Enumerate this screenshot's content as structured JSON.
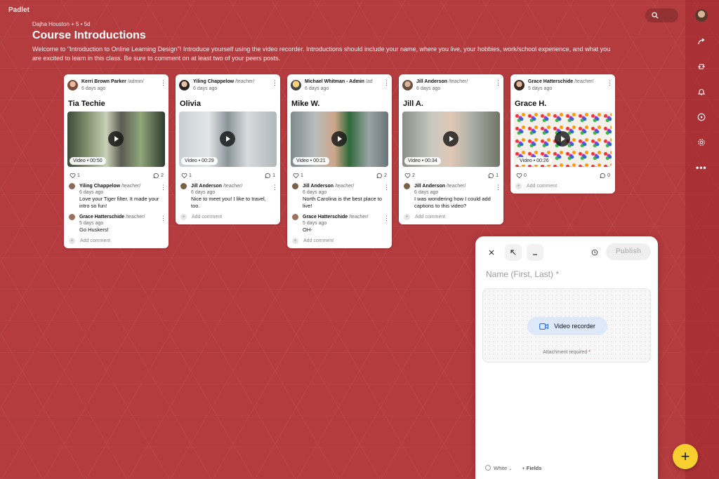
{
  "app": {
    "logo": "Padlet"
  },
  "header": {
    "author": "Dajha Houston + 5 • 5d",
    "title": "Course Introductions",
    "description": "Welcome to \"Introduction to Online Learning Design\"! Introduce yourself using the video recorder. Introductions should include your name, where you live, your hobbies, work/school experience, and what you are excited to learn in this class. Be sure to comment on at least two of your peers posts."
  },
  "rail": {
    "icons": [
      "share-icon",
      "remake-icon",
      "bell-icon",
      "play-icon",
      "gear-icon",
      "more-icon"
    ],
    "more": "•••"
  },
  "cards": [
    {
      "author": "Kerri Brown Parker",
      "role": "/admin/",
      "ago": "6 days ago",
      "title": "Tia Techie",
      "video_label": "Video",
      "duration": "00:50",
      "likes": "1",
      "comments_count": "2",
      "comments": [
        {
          "author": "Yiling Chappelow",
          "role": "/teacher/",
          "ago": "6 days ago",
          "text": "Love your Tiger filter.  It made your intro so fun!"
        },
        {
          "author": "Grace Hatterschide",
          "role": "/teacher/",
          "ago": "5 days ago",
          "text": "Go Huskers!"
        }
      ],
      "add_comment": "Add comment"
    },
    {
      "author": "Yiling Chappelow",
      "role": "/teacher/",
      "ago": "6 days ago",
      "title": "Olivia",
      "video_label": "Video",
      "duration": "00:29",
      "likes": "1",
      "comments_count": "1",
      "comments": [
        {
          "author": "Jill Anderson",
          "role": "/teacher/",
          "ago": "6 days ago",
          "text": "Nice to meet you! I like to travel, too."
        }
      ],
      "add_comment": "Add comment"
    },
    {
      "author": "Michael Whitman - Admin",
      "role": "/ad",
      "ago": "6 days ago",
      "title": "Mike W.",
      "video_label": "Video",
      "duration": "00:21",
      "likes": "1",
      "comments_count": "2",
      "comments": [
        {
          "author": "Jill Anderson",
          "role": "/teacher/",
          "ago": "6 days ago",
          "text": "North Carolina is the best place to live!"
        },
        {
          "author": "Grace Hatterschide",
          "role": "/teacher/",
          "ago": "5 days ago",
          "text": "OH-"
        }
      ],
      "add_comment": "Add comment"
    },
    {
      "author": "Jill Anderson",
      "role": "/teacher/",
      "ago": "6 days ago",
      "title": "Jill A.",
      "video_label": "Video",
      "duration": "00:34",
      "likes": "2",
      "comments_count": "1",
      "comments": [
        {
          "author": "Jill Anderson",
          "role": "/teacher/",
          "ago": "6 days ago",
          "text": "I was wondering how I could add captions to this video?"
        }
      ],
      "add_comment": "Add comment"
    },
    {
      "author": "Grace Hatterschide",
      "role": "/teacher/",
      "ago": "5 days ago",
      "title": "Grace H.",
      "video_label": "Video",
      "duration": "00:26",
      "likes": "0",
      "comments_count": "0",
      "comments": [],
      "add_comment": "Add comment"
    }
  ],
  "composer": {
    "publish": "Publish",
    "name_placeholder": "Name (First, Last) *",
    "video_recorder": "Video recorder",
    "attachment_required": "Attachment required",
    "required_star": "*",
    "color": "White",
    "fields": "Fields"
  },
  "fab": "+",
  "colors": {
    "background": "#b43b3e",
    "fab": "#f7cf2e",
    "recorder": "#dde9f8"
  }
}
